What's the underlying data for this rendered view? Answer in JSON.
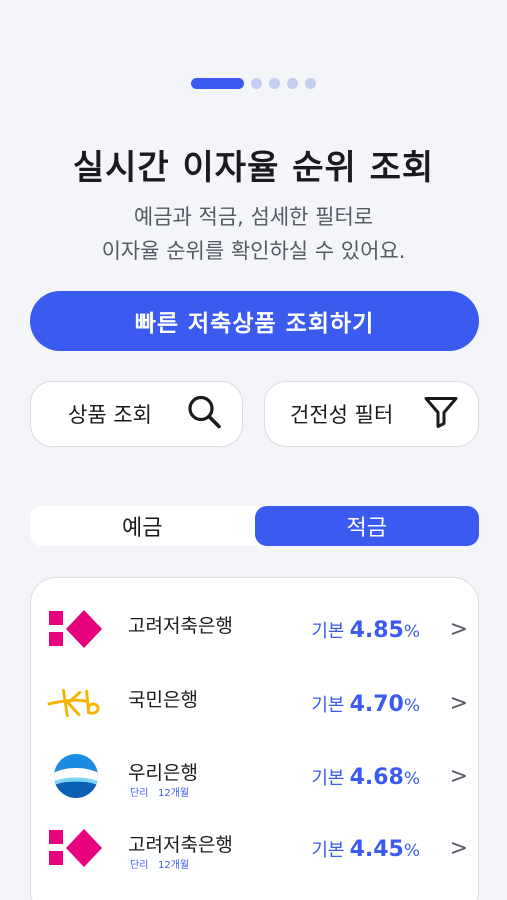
{
  "pager": {
    "count": 5,
    "active_index": 0
  },
  "hero": {
    "title": "실시간 이자율 순위 조회",
    "subtitle_line1": "예금과 적금, 섬세한 필터로",
    "subtitle_line2": "이자율 순위를 확인하실 수 있어요."
  },
  "cta": {
    "label": "빠른 저축상품 조회하기"
  },
  "filters": {
    "product_search_label": "상품 조회",
    "soundness_filter_label": "건전성 필터"
  },
  "segment": {
    "tabs": [
      {
        "label": "예금",
        "active": false
      },
      {
        "label": "적금",
        "active": true
      }
    ]
  },
  "products": [
    {
      "bank": "고려저축은행",
      "rate_label": "기본",
      "rate": "4.85",
      "unit": "%",
      "type": "",
      "term": "",
      "logo": "korea-savings-logo"
    },
    {
      "bank": "국민은행",
      "rate_label": "기본",
      "rate": "4.70",
      "unit": "%",
      "type": "",
      "term": "",
      "logo": "kb-logo"
    },
    {
      "bank": "우리은행",
      "rate_label": "기본",
      "rate": "4.68",
      "unit": "%",
      "type": "단리",
      "term": "12개월",
      "logo": "woori-logo"
    },
    {
      "bank": "고려저축은행",
      "rate_label": "기본",
      "rate": "4.45",
      "unit": "%",
      "type": "단리",
      "term": "12개월",
      "logo": "korea-savings-logo"
    }
  ],
  "colors": {
    "accent": "#3b5bf0",
    "magenta": "#e6007e",
    "kb_yellow": "#f5b400",
    "woori_blue": "#1a8be0"
  }
}
